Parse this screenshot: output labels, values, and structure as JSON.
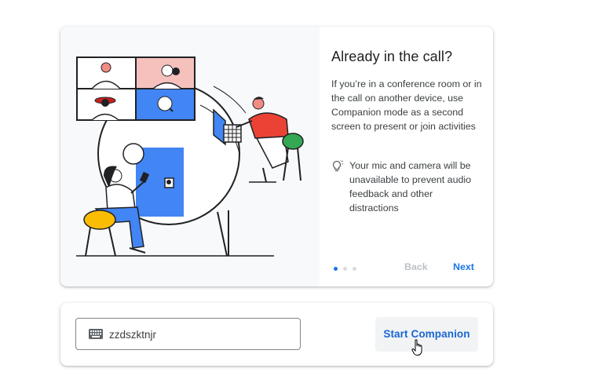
{
  "info_card": {
    "title": "Already in the call?",
    "description": "If you’re in a conference room or in the call on another device, use Companion mode as a second screen to present or join activities",
    "tip": {
      "icon": "lightbulb-icon",
      "text": "Your mic and camera will be unavailable to prevent audio feedback and other distractions"
    },
    "pager": {
      "total": 3,
      "active": 1
    },
    "back_label": "Back",
    "next_label": "Next",
    "illustration": "meeting-illustration"
  },
  "join_card": {
    "code_input": {
      "value": "zzdszktnjr",
      "icon": "keyboard-icon"
    },
    "start_button_label": "Start Companion"
  },
  "colors": {
    "accent": "#1a73e8",
    "button_text": "#1967d2",
    "disabled_text": "#bdc1c6",
    "illustration_blue": "#4285f4",
    "illustration_red": "#ea4335",
    "illustration_yellow": "#fbbc04",
    "illustration_green": "#34a853"
  },
  "cursor": "hand-pointer-icon"
}
